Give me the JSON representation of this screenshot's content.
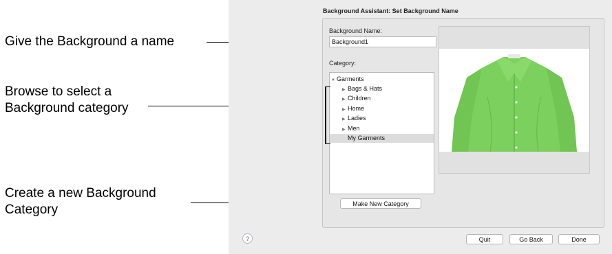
{
  "callouts": {
    "name": "Give the Background a name",
    "category_line1": "Browse to select a",
    "category_line2": "Background category",
    "new_line1": "Create a new Background",
    "new_line2": "Category"
  },
  "dialog": {
    "title": "Background Assistant: Set Background Name",
    "name_label": "Background Name:",
    "name_value": "Background1",
    "category_label": "Category:",
    "tree": [
      {
        "label": "Garments",
        "expanded": true
      },
      {
        "label": "Bags & Hats",
        "collapsed": true
      },
      {
        "label": "Children",
        "collapsed": true
      },
      {
        "label": "Home",
        "collapsed": true
      },
      {
        "label": "Ladies",
        "collapsed": true
      },
      {
        "label": "Men",
        "collapsed": true
      },
      {
        "label": "My Garments",
        "selected": true
      }
    ],
    "make_new_category": "Make New Category",
    "help": "?",
    "quit": "Quit",
    "go_back": "Go Back",
    "done": "Done"
  },
  "colors": {
    "shirt": "#7cd05e"
  }
}
